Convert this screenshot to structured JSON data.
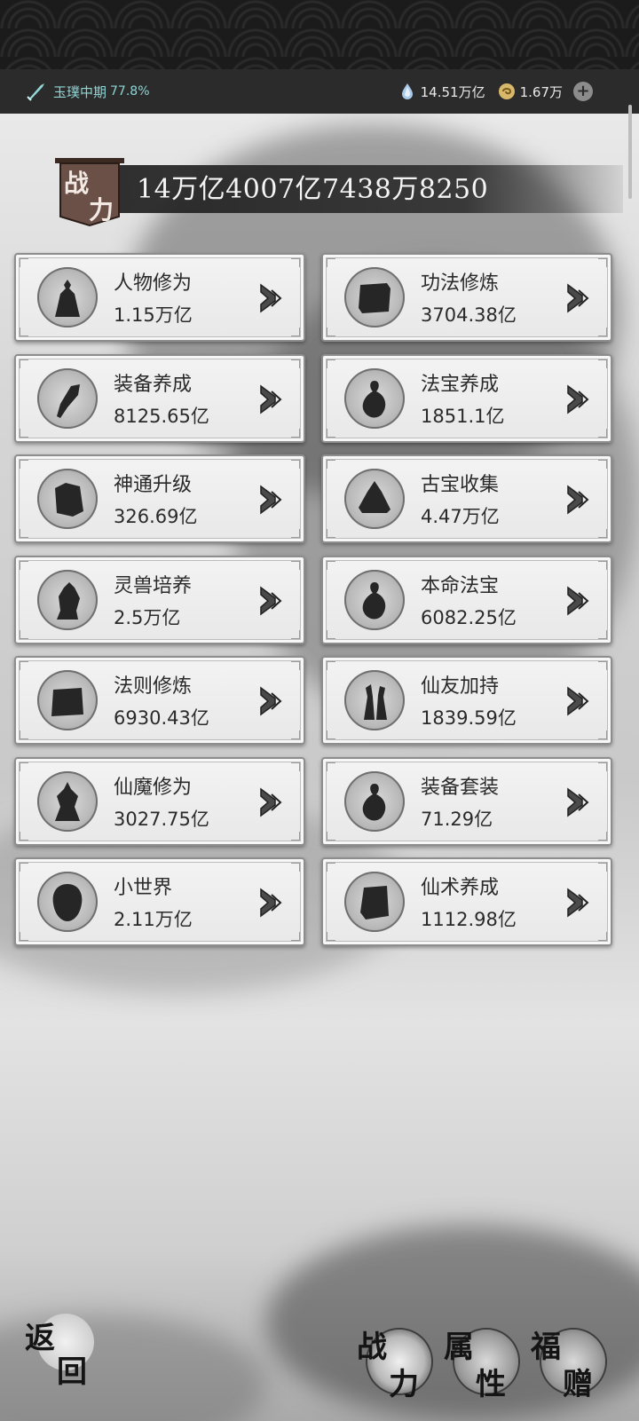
{
  "status": {
    "realm_label": "玉璞中期",
    "realm_progress": "77.8%",
    "spirit_stones": "14.51万亿",
    "coins": "1.67万"
  },
  "power": {
    "flag_top": "战",
    "flag_bottom": "力",
    "value": "14万亿4007亿7438万8250"
  },
  "categories": [
    {
      "name": "人物修为",
      "value": "1.15万亿",
      "icon": "figure-icon"
    },
    {
      "name": "功法修炼",
      "value": "3704.38亿",
      "icon": "scroll-icon"
    },
    {
      "name": "装备养成",
      "value": "8125.65亿",
      "icon": "gear-item-icon"
    },
    {
      "name": "法宝养成",
      "value": "1851.1亿",
      "icon": "gourd-icon"
    },
    {
      "name": "神通升级",
      "value": "326.69亿",
      "icon": "book-icon"
    },
    {
      "name": "古宝收集",
      "value": "4.47万亿",
      "icon": "bell-icon"
    },
    {
      "name": "灵兽培养",
      "value": "2.5万亿",
      "icon": "beast-icon"
    },
    {
      "name": "本命法宝",
      "value": "6082.25亿",
      "icon": "gourd-icon"
    },
    {
      "name": "法则修炼",
      "value": "6930.43亿",
      "icon": "chest-icon"
    },
    {
      "name": "仙友加持",
      "value": "1839.59亿",
      "icon": "companions-icon"
    },
    {
      "name": "仙魔修为",
      "value": "3027.75亿",
      "icon": "demon-icon"
    },
    {
      "name": "装备套装",
      "value": "71.29亿",
      "icon": "gourd-icon"
    },
    {
      "name": "小世界",
      "value": "2.11万亿",
      "icon": "world-icon"
    },
    {
      "name": "仙术养成",
      "value": "1112.98亿",
      "icon": "tome-icon"
    }
  ],
  "bottom": {
    "back": {
      "t1": "返",
      "t2": "回"
    },
    "tabs": [
      {
        "t1": "战",
        "t2": "力",
        "active": true
      },
      {
        "t1": "属",
        "t2": "性",
        "active": false
      },
      {
        "t1": "福",
        "t2": "赠",
        "active": false
      }
    ]
  }
}
